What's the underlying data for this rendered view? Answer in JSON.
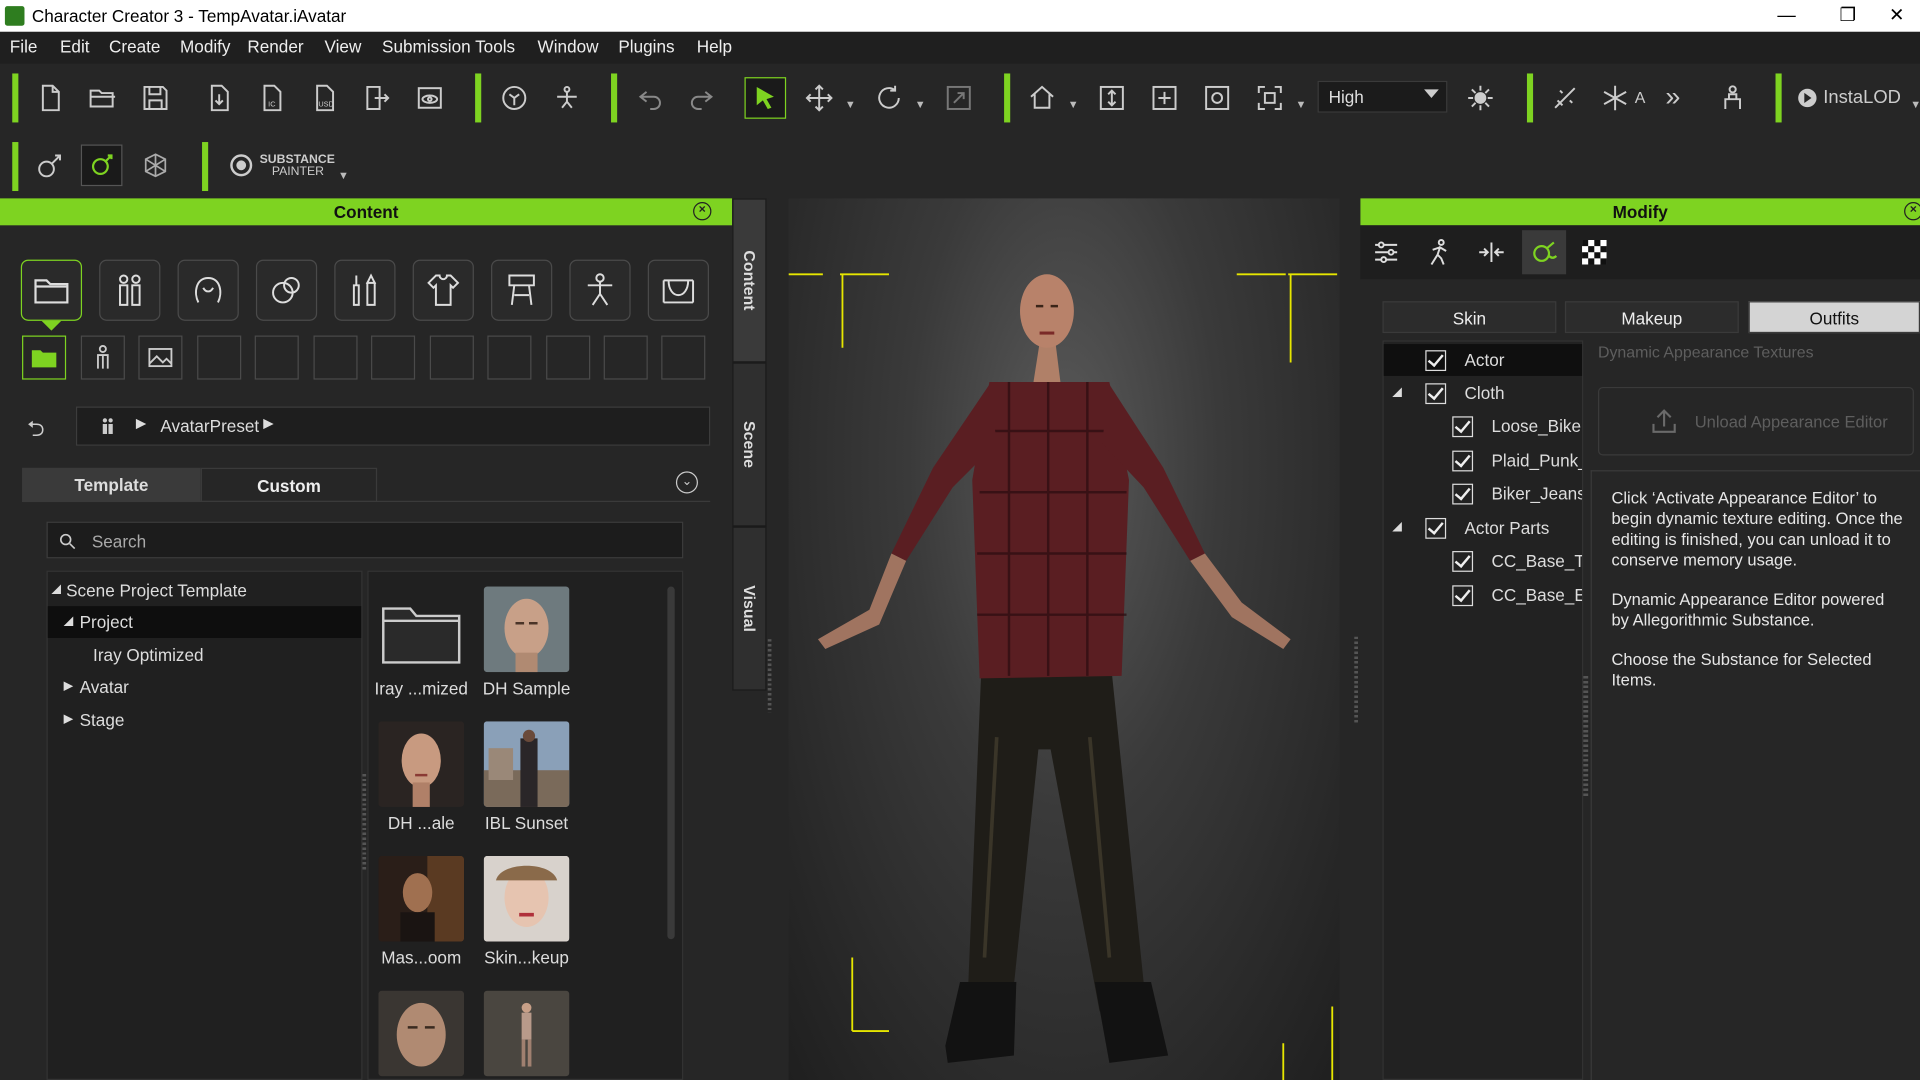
{
  "window": {
    "title": "Character Creator 3 - TempAvatar.iAvatar",
    "minimize": "—",
    "maximize": "❐",
    "close": "✕"
  },
  "menu": [
    "File",
    "Edit",
    "Create",
    "Modify",
    "Render",
    "View",
    "Submission Tools",
    "Window",
    "Plugins",
    "Help"
  ],
  "toolbar": {
    "quality_select": "High",
    "instalod_label": "InstaLOD",
    "auto_label": "A",
    "substance_label_1": "SUBSTANCE",
    "substance_label_2": "PAINTER"
  },
  "content_panel": {
    "title": "Content",
    "breadcrumb": "AvatarPreset",
    "tabs": [
      "Template",
      "Custom"
    ],
    "search_placeholder": "Search",
    "tree": [
      {
        "label": "Scene Project Template",
        "expanded": true
      },
      {
        "label": "Project",
        "expanded": true
      },
      {
        "label": "Iray Optimized"
      },
      {
        "label": "Avatar",
        "expanded": false
      },
      {
        "label": "Stage",
        "expanded": false
      }
    ],
    "items": [
      {
        "label": "Iray ...mized",
        "icon": "folder-icon"
      },
      {
        "label": "DH Sample",
        "icon": "male-head-thumbnail"
      },
      {
        "label": "DH ...ale",
        "icon": "female-head-thumbnail"
      },
      {
        "label": "IBL Sunset",
        "icon": "sunset-scene-thumbnail"
      },
      {
        "label": "Mas...oom",
        "icon": "dark-room-thumbnail"
      },
      {
        "label": "Skin...keup",
        "icon": "makeup-face-thumbnail"
      },
      {
        "label": "",
        "icon": "male-face-thumbnail"
      },
      {
        "label": "",
        "icon": "full-body-thumbnail"
      }
    ]
  },
  "side_tabs": [
    "Content",
    "Scene",
    "Visual"
  ],
  "modify_panel": {
    "title": "Modify",
    "tabs": [
      "Skin",
      "Makeup",
      "Outfits"
    ],
    "active_tab": "Outfits",
    "objects": [
      {
        "label": "Actor",
        "checked": true,
        "level": 0,
        "selected": true
      },
      {
        "label": "Cloth",
        "checked": true,
        "level": 0,
        "expander": true
      },
      {
        "label": "Loose_Bike",
        "checked": true,
        "level": 1
      },
      {
        "label": "Plaid_Punk_",
        "checked": true,
        "level": 1
      },
      {
        "label": "Biker_Jeans",
        "checked": true,
        "level": 1
      },
      {
        "label": "Actor Parts",
        "checked": true,
        "level": 0,
        "expander": true
      },
      {
        "label": "CC_Base_T",
        "checked": true,
        "level": 1
      },
      {
        "label": "CC_Base_E",
        "checked": true,
        "level": 1
      }
    ],
    "section_label": "Dynamic Appearance Textures",
    "unload_button": "Unload Appearance Editor",
    "info": [
      "Click ‘Activate Appearance Editor’ to begin dynamic texture editing. Once the editing is finished, you can unload it to conserve memory usage.",
      "Dynamic Appearance Editor powered by Allegorithmic Substance.",
      "Choose the Substance for Selected Items."
    ]
  },
  "colors": {
    "accent": "#7ed321",
    "bg": "#262626",
    "frame_marker": "#e6e600"
  }
}
